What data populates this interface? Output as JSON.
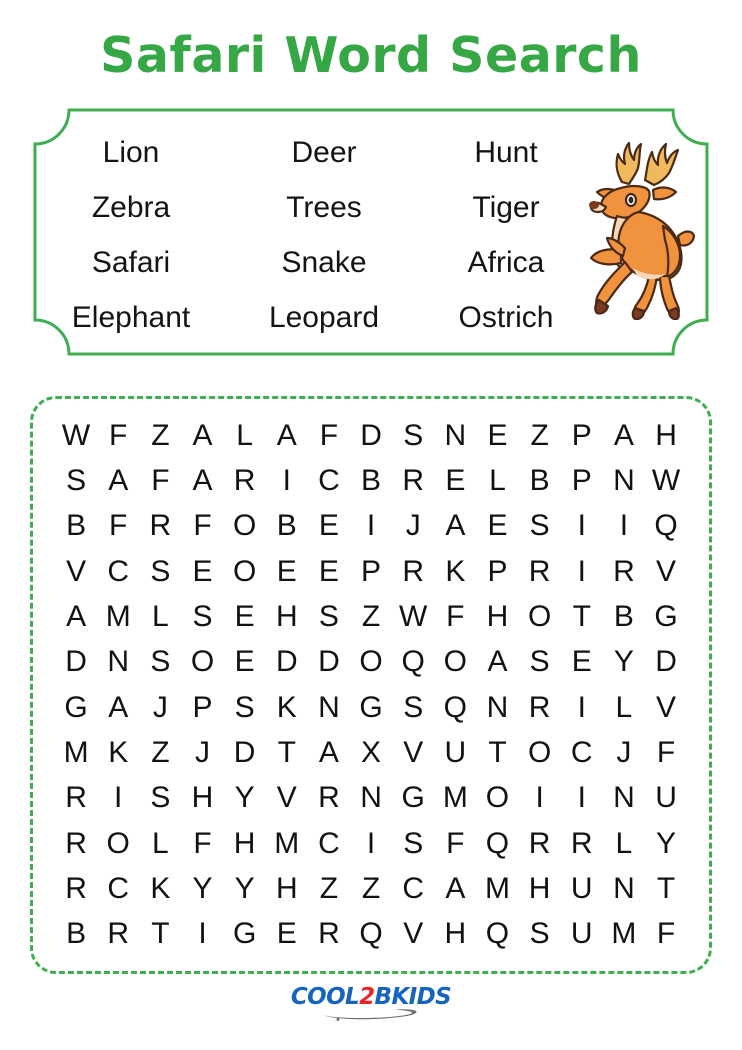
{
  "page": {
    "title": "Safari Word Search",
    "title_color": "#36a745",
    "border_color": "#3fae52",
    "background": "#ffffff"
  },
  "word_list": {
    "rows": [
      [
        "Lion",
        "Deer",
        "Hunt"
      ],
      [
        "Zebra",
        "Trees",
        "Tiger"
      ],
      [
        "Safari",
        "Snake",
        "Africa"
      ],
      [
        "Elephant",
        "Leopard",
        "Ostrich"
      ]
    ],
    "words": [
      "Lion",
      "Deer",
      "Hunt",
      "Zebra",
      "Trees",
      "Tiger",
      "Safari",
      "Snake",
      "Africa",
      "Elephant",
      "Leopard",
      "Ostrich"
    ]
  },
  "illustration": {
    "name": "deer-illustration",
    "body_color": "#f0923e",
    "belly_color": "#f7d9b8",
    "antler_color": "#f0b95e",
    "hoof_color": "#7a3b20",
    "outline_color": "#4a2a14"
  },
  "grid": {
    "columns": 15,
    "rows": 12,
    "letters": [
      [
        "W",
        "F",
        "Z",
        "A",
        "L",
        "A",
        "F",
        "D",
        "S",
        "N",
        "E",
        "Z",
        "P",
        "A",
        "H"
      ],
      [
        "S",
        "A",
        "F",
        "A",
        "R",
        "I",
        "C",
        "B",
        "R",
        "E",
        "L",
        "B",
        "P",
        "N",
        "W"
      ],
      [
        "B",
        "F",
        "R",
        "F",
        "O",
        "B",
        "E",
        "I",
        "J",
        "A",
        "E",
        "S",
        "I",
        "I",
        "Q"
      ],
      [
        "V",
        "C",
        "S",
        "E",
        "O",
        "E",
        "E",
        "P",
        "R",
        "K",
        "P",
        "R",
        "I",
        "R",
        "V"
      ],
      [
        "A",
        "M",
        "L",
        "S",
        "E",
        "H",
        "S",
        "Z",
        "W",
        "F",
        "H",
        "O",
        "T",
        "B",
        "G"
      ],
      [
        "D",
        "N",
        "S",
        "O",
        "E",
        "D",
        "D",
        "O",
        "Q",
        "O",
        "A",
        "S",
        "E",
        "Y",
        "D"
      ],
      [
        "G",
        "A",
        "J",
        "P",
        "S",
        "K",
        "N",
        "G",
        "S",
        "Q",
        "N",
        "R",
        "I",
        "L",
        "V"
      ],
      [
        "M",
        "K",
        "Z",
        "J",
        "D",
        "T",
        "A",
        "X",
        "V",
        "U",
        "T",
        "O",
        "C",
        "J",
        "F"
      ],
      [
        "R",
        "I",
        "S",
        "H",
        "Y",
        "V",
        "R",
        "N",
        "G",
        "M",
        "O",
        "I",
        "I",
        "N",
        "U"
      ],
      [
        "R",
        "O",
        "L",
        "F",
        "H",
        "M",
        "C",
        "I",
        "S",
        "F",
        "Q",
        "R",
        "R",
        "L",
        "Y"
      ],
      [
        "R",
        "C",
        "K",
        "Y",
        "Y",
        "H",
        "Z",
        "Z",
        "C",
        "A",
        "M",
        "H",
        "U",
        "N",
        "T"
      ],
      [
        "B",
        "R",
        "T",
        "I",
        "G",
        "E",
        "R",
        "Q",
        "V",
        "H",
        "Q",
        "S",
        "U",
        "M",
        "F"
      ]
    ]
  },
  "footer": {
    "logo_part1": "COOL",
    "logo_part2": "2",
    "logo_part3": "BKIDS",
    "logo_full": "COOL2BKIDS",
    "blue": "#1565c0",
    "red": "#e8232a"
  }
}
